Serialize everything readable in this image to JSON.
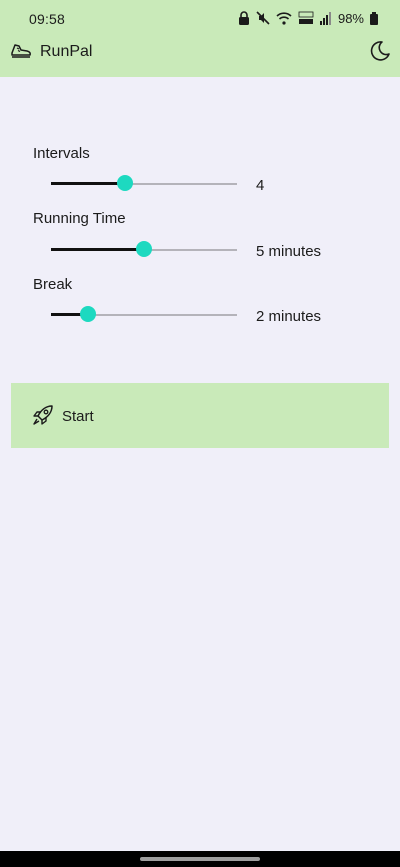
{
  "status_bar": {
    "time": "09:58",
    "battery_percent": "98%",
    "icons": [
      "lock-icon",
      "mute-icon",
      "wifi-icon",
      "lte-icon",
      "signal-icon",
      "battery-icon"
    ]
  },
  "app_bar": {
    "title": "RunPal",
    "logo_icon": "running-shoe-icon",
    "theme_toggle_icon": "moon-icon"
  },
  "settings": [
    {
      "label": "Intervals",
      "value_text": "4",
      "level": 0.4
    },
    {
      "label": "Running Time",
      "value_text": "5 minutes",
      "level": 0.5
    },
    {
      "label": "Break",
      "value_text": "2 minutes",
      "level": 0.2
    }
  ],
  "start_button": {
    "label": "Start",
    "icon": "rocket-icon"
  },
  "colors": {
    "header_bg": "#c9eab9",
    "page_bg": "#f0eff9",
    "thumb": "#1dd9c0",
    "track_active": "#111111",
    "track_inactive": "#b4b3ba"
  }
}
